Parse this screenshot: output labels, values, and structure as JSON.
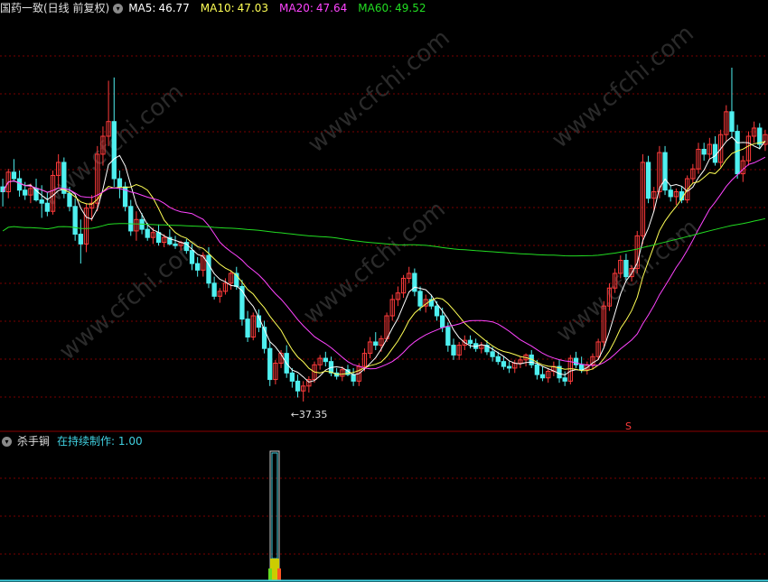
{
  "main_panel": {
    "title": "国药一致(日线 前复权)",
    "ma_labels": [
      {
        "label": "MA5:",
        "value": "46.77",
        "color": "#ffffff"
      },
      {
        "label": "MA10:",
        "value": "47.03",
        "color": "#ffff55"
      },
      {
        "label": "MA20:",
        "value": "47.64",
        "color": "#ff44ff"
      },
      {
        "label": "MA60:",
        "value": "49.52",
        "color": "#22dd22"
      }
    ],
    "low_marker": "←37.35",
    "signal_marker": "S",
    "watermark": "www.cfchi.com"
  },
  "sub_panel": {
    "title": "杀手锏",
    "indicator_label": "在持续制作: 1.00"
  },
  "colors": {
    "up": "#ff3b3b",
    "down": "#4ff0f0",
    "grid": "#7a0000",
    "separator": "#8b0000",
    "ma5": "#ffffff",
    "ma10": "#ffff55",
    "ma20": "#ff44ff",
    "ma60": "#22dd22",
    "watermark": "#2a2a2a"
  },
  "chart_data": {
    "type": "candlestick",
    "y_low_value": 37.35,
    "candles": [
      [
        50.5,
        51,
        49.3,
        50.2
      ],
      [
        50.2,
        51.6,
        49.8,
        51.4
      ],
      [
        51.4,
        52.2,
        50.8,
        51.0
      ],
      [
        51.0,
        51.5,
        49.9,
        50.3
      ],
      [
        50.3,
        50.8,
        49.7,
        50.0
      ],
      [
        50.0,
        50.7,
        49.5,
        50.4
      ],
      [
        50.4,
        51.0,
        49.6,
        49.7
      ],
      [
        49.7,
        50.6,
        48.6,
        49.5
      ],
      [
        49.5,
        50.2,
        48.7,
        49.0
      ],
      [
        49.0,
        51.5,
        48.8,
        51.2
      ],
      [
        51.2,
        52.5,
        50.5,
        52.0
      ],
      [
        52.0,
        52.3,
        49.8,
        50.1
      ],
      [
        50.1,
        50.5,
        49.0,
        49.3
      ],
      [
        49.3,
        49.8,
        47.2,
        47.6
      ],
      [
        47.6,
        48.5,
        45.8,
        47.0
      ],
      [
        47.0,
        49.5,
        46.5,
        49.2
      ],
      [
        49.2,
        50.0,
        48.4,
        49.5
      ],
      [
        49.5,
        53.0,
        49.0,
        52.5
      ],
      [
        52.5,
        54.2,
        51.8,
        53.6
      ],
      [
        53.6,
        57.0,
        53.0,
        54.5
      ],
      [
        54.5,
        57.2,
        50.5,
        51.0
      ],
      [
        51.0,
        51.5,
        49.8,
        50.5
      ],
      [
        50.5,
        50.8,
        49.0,
        49.3
      ],
      [
        49.3,
        49.7,
        47.5,
        47.8
      ],
      [
        47.8,
        49.0,
        47.2,
        48.5
      ],
      [
        48.5,
        48.9,
        47.6,
        47.9
      ],
      [
        47.9,
        48.3,
        47.2,
        47.4
      ],
      [
        47.4,
        48.0,
        47.0,
        47.7
      ],
      [
        47.7,
        48.2,
        46.9,
        47.1
      ],
      [
        47.1,
        47.6,
        46.8,
        47.4
      ],
      [
        47.4,
        47.9,
        46.9,
        47.0
      ],
      [
        47.0,
        47.5,
        46.7,
        46.9
      ],
      [
        46.9,
        47.2,
        46.6,
        47.1
      ],
      [
        47.1,
        47.3,
        46.4,
        46.6
      ],
      [
        46.6,
        47.0,
        45.4,
        45.8
      ],
      [
        45.8,
        46.2,
        45.0,
        45.4
      ],
      [
        45.4,
        46.5,
        45.0,
        46.3
      ],
      [
        46.3,
        46.8,
        44.3,
        44.6
      ],
      [
        44.6,
        45.0,
        43.6,
        43.8
      ],
      [
        43.8,
        44.3,
        43.4,
        44.1
      ],
      [
        44.1,
        44.9,
        43.9,
        44.6
      ],
      [
        44.6,
        45.4,
        44.2,
        45.2
      ],
      [
        45.2,
        45.6,
        44.2,
        44.4
      ],
      [
        44.4,
        44.8,
        42.0,
        42.4
      ],
      [
        42.4,
        42.9,
        41.0,
        41.3
      ],
      [
        41.3,
        42.8,
        41.1,
        42.6
      ],
      [
        42.6,
        43.0,
        41.6,
        41.9
      ],
      [
        41.9,
        42.3,
        40.3,
        40.6
      ],
      [
        40.6,
        41.0,
        38.3,
        38.7
      ],
      [
        38.7,
        39.9,
        38.4,
        39.7
      ],
      [
        39.7,
        40.5,
        39.4,
        40.3
      ],
      [
        40.3,
        40.8,
        38.8,
        39.1
      ],
      [
        39.1,
        39.4,
        38.2,
        38.6
      ],
      [
        38.6,
        39.0,
        37.6,
        38.0
      ],
      [
        38.0,
        38.6,
        37.35,
        38.3
      ],
      [
        38.3,
        38.9,
        37.9,
        38.7
      ],
      [
        38.7,
        39.8,
        38.5,
        39.6
      ],
      [
        39.6,
        40.2,
        39.3,
        40.0
      ],
      [
        40.0,
        40.4,
        39.5,
        39.8
      ],
      [
        39.8,
        40.1,
        38.9,
        39.1
      ],
      [
        39.1,
        39.4,
        38.7,
        38.9
      ],
      [
        38.9,
        39.5,
        38.6,
        39.3
      ],
      [
        39.3,
        39.6,
        38.9,
        39.0
      ],
      [
        39.0,
        39.4,
        38.3,
        38.6
      ],
      [
        38.6,
        39.7,
        38.3,
        39.5
      ],
      [
        39.5,
        40.6,
        39.2,
        40.3
      ],
      [
        40.3,
        41.3,
        40.0,
        41.0
      ],
      [
        41.0,
        41.6,
        40.5,
        40.8
      ],
      [
        40.8,
        41.4,
        40.4,
        41.2
      ],
      [
        41.2,
        42.8,
        41.0,
        42.6
      ],
      [
        42.6,
        43.9,
        42.3,
        43.6
      ],
      [
        43.6,
        44.4,
        43.2,
        44.0
      ],
      [
        44.0,
        45.1,
        43.7,
        44.9
      ],
      [
        44.9,
        45.6,
        44.6,
        45.2
      ],
      [
        45.2,
        45.5,
        43.8,
        44.1
      ],
      [
        44.1,
        44.4,
        42.9,
        43.2
      ],
      [
        43.2,
        43.9,
        42.8,
        43.6
      ],
      [
        43.6,
        43.9,
        43.0,
        43.2
      ],
      [
        43.2,
        43.5,
        42.3,
        42.6
      ],
      [
        42.6,
        43.1,
        41.6,
        41.9
      ],
      [
        41.9,
        42.2,
        40.4,
        40.8
      ],
      [
        40.8,
        41.2,
        39.9,
        40.2
      ],
      [
        40.2,
        41.0,
        39.9,
        40.8
      ],
      [
        40.8,
        41.4,
        40.5,
        41.1
      ],
      [
        41.1,
        41.4,
        40.6,
        40.9
      ],
      [
        40.9,
        41.2,
        40.4,
        40.6
      ],
      [
        40.6,
        41.0,
        40.3,
        40.8
      ],
      [
        40.8,
        41.1,
        40.2,
        40.4
      ],
      [
        40.4,
        40.7,
        39.8,
        40.1
      ],
      [
        40.1,
        40.4,
        39.6,
        39.8
      ],
      [
        39.8,
        40.1,
        39.3,
        39.5
      ],
      [
        39.5,
        39.8,
        39.1,
        39.4
      ],
      [
        39.4,
        39.9,
        39.1,
        39.7
      ],
      [
        39.7,
        40.1,
        39.4,
        39.9
      ],
      [
        39.9,
        40.3,
        39.5,
        40.2
      ],
      [
        40.2,
        40.5,
        39.4,
        39.6
      ],
      [
        39.6,
        39.9,
        38.7,
        39.0
      ],
      [
        39.0,
        39.5,
        38.6,
        38.8
      ],
      [
        38.8,
        39.4,
        38.5,
        39.2
      ],
      [
        39.2,
        39.8,
        38.9,
        39.5
      ],
      [
        39.5,
        39.9,
        38.5,
        38.8
      ],
      [
        38.8,
        39.2,
        38.3,
        38.6
      ],
      [
        38.6,
        40.2,
        38.4,
        40.0
      ],
      [
        40.0,
        40.4,
        39.4,
        39.6
      ],
      [
        39.6,
        40.1,
        39.1,
        39.3
      ],
      [
        39.3,
        39.8,
        39.0,
        39.6
      ],
      [
        39.6,
        40.3,
        39.3,
        40.1
      ],
      [
        40.1,
        41.2,
        39.9,
        41.0
      ],
      [
        41.0,
        43.5,
        40.7,
        43.2
      ],
      [
        43.2,
        44.6,
        42.9,
        44.3
      ],
      [
        44.3,
        45.5,
        44.0,
        45.2
      ],
      [
        45.2,
        46.3,
        44.9,
        46.0
      ],
      [
        46.0,
        46.4,
        44.8,
        45.0
      ],
      [
        45.0,
        45.7,
        44.7,
        45.5
      ],
      [
        45.5,
        47.8,
        45.2,
        47.5
      ],
      [
        47.5,
        52.5,
        47.0,
        52.0
      ],
      [
        52.0,
        52.4,
        49.5,
        49.8
      ],
      [
        49.8,
        50.5,
        49.0,
        50.2
      ],
      [
        50.2,
        53.0,
        49.8,
        52.6
      ],
      [
        52.6,
        53.0,
        50.0,
        50.3
      ],
      [
        50.3,
        50.6,
        49.6,
        49.9
      ],
      [
        49.9,
        50.4,
        49.4,
        50.2
      ],
      [
        50.2,
        50.5,
        49.5,
        49.7
      ],
      [
        49.7,
        51.2,
        49.5,
        51.0
      ],
      [
        51.0,
        51.9,
        50.7,
        51.6
      ],
      [
        51.6,
        53.2,
        51.3,
        52.8
      ],
      [
        52.8,
        53.2,
        52.1,
        52.5
      ],
      [
        52.5,
        53.5,
        52.2,
        53.1
      ],
      [
        53.1,
        53.6,
        51.8,
        52.0
      ],
      [
        52.0,
        54.0,
        51.7,
        53.7
      ],
      [
        53.7,
        55.5,
        53.3,
        55.1
      ],
      [
        55.1,
        57.8,
        53.5,
        53.9
      ],
      [
        53.9,
        54.3,
        51.0,
        51.3
      ],
      [
        51.3,
        52.4,
        50.8,
        52.1
      ],
      [
        52.1,
        53.9,
        51.8,
        53.6
      ],
      [
        53.6,
        54.5,
        53.2,
        54.1
      ],
      [
        54.1,
        54.4,
        52.8,
        53.1
      ],
      [
        53.1,
        54.0,
        52.7,
        53.7
      ]
    ],
    "ma_periods": [
      5,
      10,
      20,
      60
    ],
    "signal_bar_index": 61,
    "indicator": {
      "name": "在持续制作",
      "value": 1.0,
      "signal_index": 61
    }
  }
}
